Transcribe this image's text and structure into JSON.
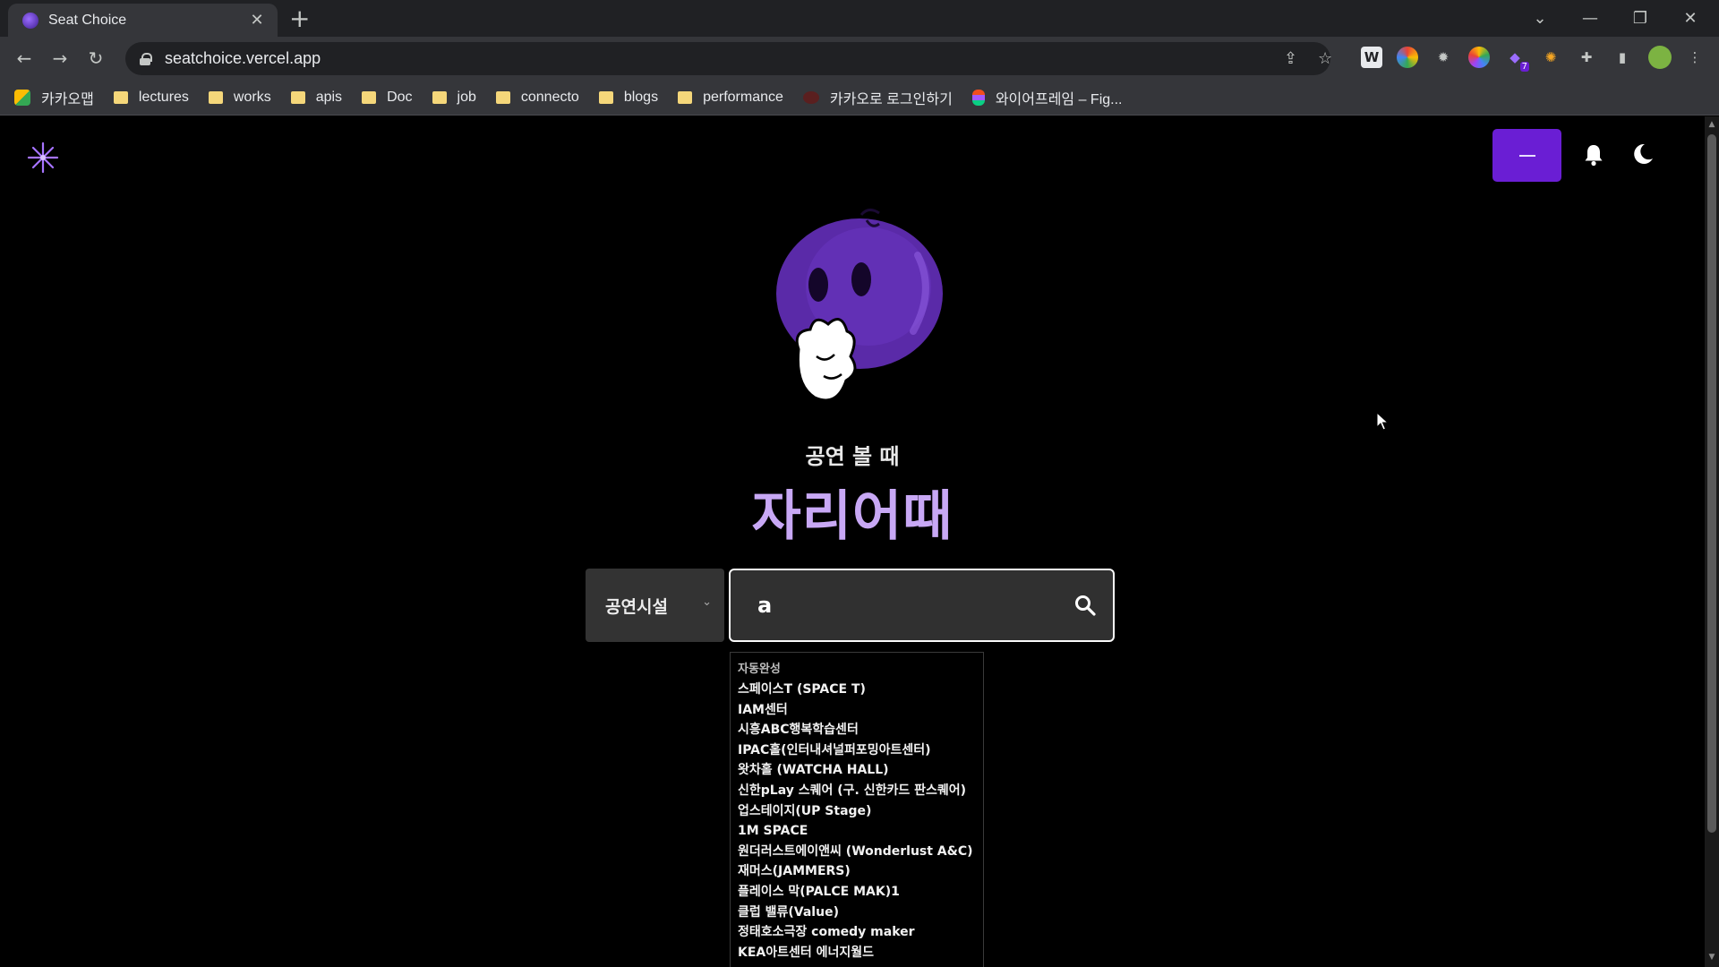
{
  "browser": {
    "tab_title": "Seat Choice",
    "url": "seatchoice.vercel.app",
    "bookmarks": [
      {
        "label": "카카오맵",
        "icon": "map-pin-icon"
      },
      {
        "label": "lectures",
        "icon": "folder-icon"
      },
      {
        "label": "works",
        "icon": "folder-icon"
      },
      {
        "label": "apis",
        "icon": "folder-icon"
      },
      {
        "label": "Doc",
        "icon": "folder-icon"
      },
      {
        "label": "job",
        "icon": "folder-icon"
      },
      {
        "label": "connecto",
        "icon": "folder-icon"
      },
      {
        "label": "blogs",
        "icon": "folder-icon"
      },
      {
        "label": "performance",
        "icon": "folder-icon"
      },
      {
        "label": "카카오로 로그인하기",
        "icon": "kakao-icon"
      },
      {
        "label": "와이어프레임 – Fig...",
        "icon": "figma-icon"
      }
    ],
    "extension_badge": "7"
  },
  "page": {
    "subtitle": "공연 볼 때",
    "title": "자리어때",
    "accent_color": "#6a1ed4",
    "title_color": "#c8a8f5",
    "category_select": {
      "value": "공연시설"
    },
    "search": {
      "value": "a"
    },
    "autocomplete": {
      "header": "자동완성",
      "items": [
        "스페이스T (SPACE T)",
        "IAM센터",
        "시흥ABC행복학습센터",
        "IPAC홀(인터내셔널퍼포밍아트센터)",
        "왓차홀 (WATCHA HALL)",
        "신한pLay 스퀘어 (구. 신한카드 판스퀘어)",
        "업스테이지(UP Stage)",
        "1M SPACE",
        "원더러스트에이앤씨 (Wonderlust A&C)",
        "재머스(JAMMERS)",
        "플레이스 막(PALCE MAK)1",
        "클럽 밸류(Value)",
        "정태호소극장 comedy maker",
        "KEA아트센터 에너지월드"
      ]
    }
  }
}
